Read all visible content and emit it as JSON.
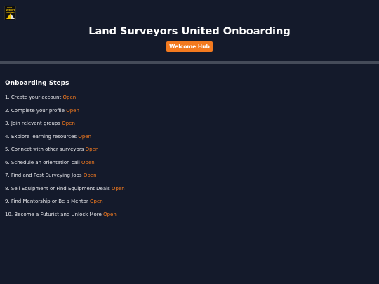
{
  "header": {
    "logo_text": "LAND\nSURVEYORS\nUNITED",
    "title": "Land Surveyors United Onboarding",
    "hub_button_label": "Welcome Hub"
  },
  "section": {
    "title": "Onboarding Steps"
  },
  "steps": [
    {
      "label": "1. Create your account",
      "link": "Open"
    },
    {
      "label": "2. Complete your profile",
      "link": "Open"
    },
    {
      "label": "3. Join relevant groups",
      "link": "Open"
    },
    {
      "label": "4. Explore learning resources",
      "link": "Open"
    },
    {
      "label": "5. Connect with other surveyors",
      "link": "Open"
    },
    {
      "label": "6. Schedule an orientation call",
      "link": "Open"
    },
    {
      "label": "7. Find and Post Surveying Jobs",
      "link": "Open"
    },
    {
      "label": "8. Sell Equipment or Find Equipment Deals",
      "link": "Open"
    },
    {
      "label": "9. Find Mentorship or Be a Mentor",
      "link": "Open"
    },
    {
      "label": "10. Become a Futurist and Unlock More",
      "link": "Open"
    }
  ],
  "colors": {
    "background": "#141a2b",
    "accent": "#f37a1f",
    "divider": "#454b59",
    "logo_yellow": "#f2c200"
  }
}
